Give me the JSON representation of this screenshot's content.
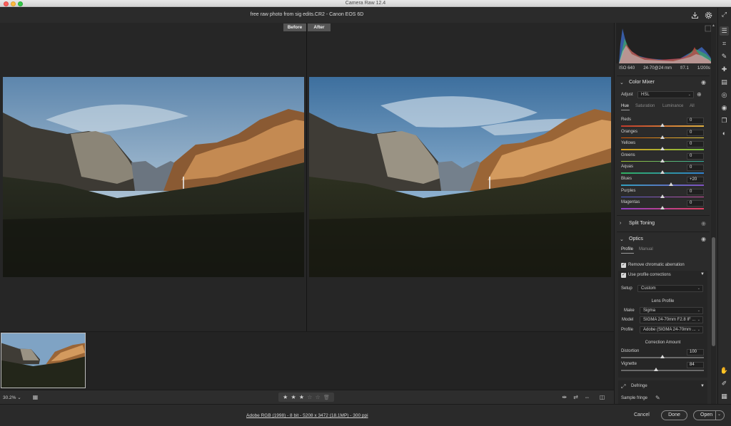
{
  "window": {
    "app_title": "Camera Raw 12.4"
  },
  "header": {
    "file_title": "free raw photo from sig edits.CR2  -  Canon EOS 6D"
  },
  "preview": {
    "before_label": "Before",
    "after_label": "After"
  },
  "exif": {
    "iso": "ISO 640",
    "lens": "24-70@24 mm",
    "aperture": "f/7.1",
    "shutter": "1/200s"
  },
  "color_mixer": {
    "title": "Color Mixer",
    "adjust_label": "Adjust",
    "adjust_value": "HSL",
    "tabs": [
      "Hue",
      "Saturation",
      "Luminance",
      "All"
    ],
    "active_tab": "Hue",
    "sliders": [
      {
        "name": "Reds",
        "value": "0",
        "num": 0,
        "color_from": "#c0392b",
        "color_to": "#e0b040"
      },
      {
        "name": "Oranges",
        "value": "0",
        "num": 0,
        "color_from": "#d35400",
        "color_to": "#e8d040"
      },
      {
        "name": "Yellows",
        "value": "0",
        "num": 0,
        "color_from": "#d8a020",
        "color_to": "#7ac040"
      },
      {
        "name": "Greens",
        "value": "0",
        "num": 0,
        "color_from": "#a0c030",
        "color_to": "#30b0a0"
      },
      {
        "name": "Aquas",
        "value": "0",
        "num": 0,
        "color_from": "#30b060",
        "color_to": "#3080d0"
      },
      {
        "name": "Blues",
        "value": "+20",
        "num": 20,
        "color_from": "#30a0c0",
        "color_to": "#8050c0"
      },
      {
        "name": "Purples",
        "value": "0",
        "num": 0,
        "color_from": "#5060d0",
        "color_to": "#d050a0"
      },
      {
        "name": "Magentas",
        "value": "0",
        "num": 0,
        "color_from": "#9040c0",
        "color_to": "#e04060"
      }
    ]
  },
  "split_toning": {
    "title": "Split Toning"
  },
  "optics": {
    "title": "Optics",
    "tabs": [
      "Profile",
      "Manual"
    ],
    "active_tab": "Profile",
    "remove_ca": "Remove chromatic aberration",
    "use_profile": "Use profile corrections",
    "setup_label": "Setup",
    "setup_value": "Custom",
    "lens_profile_title": "Lens Profile",
    "make_label": "Make",
    "make_value": "Sigma",
    "model_label": "Model",
    "model_value": "SIGMA 24-70mm F2.8 IF ...",
    "profile_label": "Profile",
    "profile_value": "Adobe (SIGMA 24-70mm ...",
    "correction_title": "Correction Amount",
    "distortion_label": "Distortion",
    "distortion_value": "100",
    "distortion_num": 100,
    "vignette_label": "Vignette",
    "vignette_value": "84",
    "vignette_num": 84
  },
  "defringe": {
    "title": "Defringe",
    "sample_fringe": "Sample fringe"
  },
  "bottombar": {
    "zoom": "30.2%",
    "rating": 3,
    "max_rating": 5
  },
  "footer": {
    "workflow": "Adobe RGB (1998) - 8 bit - 5208 x 3472 (18.1MP) - 300 ppi",
    "cancel": "Cancel",
    "done": "Done",
    "open": "Open"
  },
  "icons": {
    "star_on": "★",
    "star_off": "☆"
  }
}
